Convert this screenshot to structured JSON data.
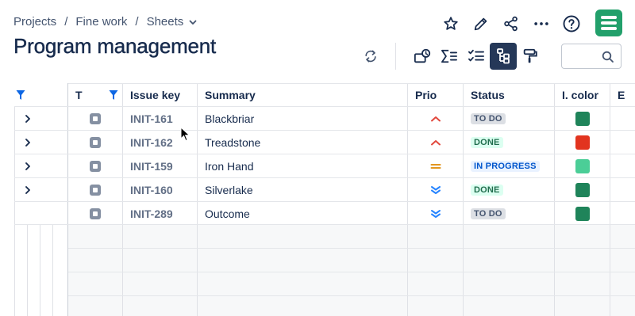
{
  "breadcrumb": {
    "items": [
      "Projects",
      "Fine work",
      "Sheets"
    ],
    "separator": "/"
  },
  "page": {
    "title": "Program management"
  },
  "search": {
    "value": ""
  },
  "columns": {
    "t": "T",
    "issue_key": "Issue key",
    "summary": "Summary",
    "prio": "Prio",
    "status": "Status",
    "i_color": "I. color",
    "extra": "E"
  },
  "rows": [
    {
      "key": "INIT-161",
      "summary": "Blackbriar",
      "priority": "high",
      "status": "TO DO",
      "status_type": "todo",
      "color": "#1f845a",
      "expandable": true
    },
    {
      "key": "INIT-162",
      "summary": "Treadstone",
      "priority": "high",
      "status": "DONE",
      "status_type": "done",
      "color": "#e2341f",
      "expandable": true
    },
    {
      "key": "INIT-159",
      "summary": "Iron Hand",
      "priority": "medium",
      "status": "IN PROGRESS",
      "status_type": "inprogress",
      "color": "#4bce97",
      "expandable": true
    },
    {
      "key": "INIT-160",
      "summary": "Silverlake",
      "priority": "lowest",
      "status": "DONE",
      "status_type": "done",
      "color": "#1f845a",
      "expandable": true
    },
    {
      "key": "INIT-289",
      "summary": "Outcome",
      "priority": "lowest",
      "status": "TO DO",
      "status_type": "todo",
      "color": "#1f845a",
      "expandable": false
    }
  ],
  "icons": {
    "header": [
      "star-icon",
      "pencil-icon",
      "share-icon",
      "more-icon",
      "help-icon",
      "app-logo-icon"
    ],
    "toolbar": [
      "refresh-icon",
      "hierarchy-view-icon",
      "sum-icon",
      "checklist-icon",
      "tree-icon",
      "format-paint-icon"
    ],
    "search": "search-icon"
  },
  "colors": {
    "brand": "#22a06b",
    "active_toolbar": "#253858",
    "filter_accent": "#0c66e4"
  }
}
